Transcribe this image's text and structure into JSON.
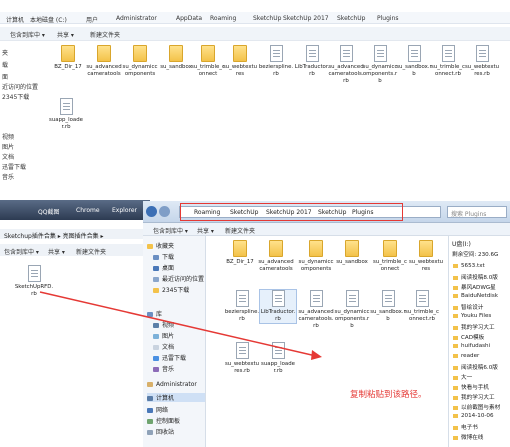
{
  "top_window": {
    "breadcrumb": [
      "计算机",
      "本地磁盘 (C:)",
      "用户",
      "Administrator",
      "AppData",
      "Roaming",
      "SketchUp",
      "SketchUp 2017",
      "SketchUp",
      "Plugins"
    ],
    "toolbar": [
      "包含到库中 ▾",
      "共享 ▾",
      "新建文件夹"
    ],
    "sidebar": [
      "夹",
      "载",
      "面",
      "近访问的位置",
      "2345下载",
      "视频",
      "图片",
      "文档",
      "迅雷下载",
      "音乐"
    ],
    "files": [
      "BZ_Dir_17",
      "su_advancedcameratools",
      "su_dynamiccomponents",
      "su_sandbox",
      "su_trimble_connect",
      "su_webtextures",
      "bezierspline.rb",
      "LibTraductor.rb",
      "su_advancedcameratools.rb",
      "su_dynamiccomponents.rb",
      "su_sandbox.rb",
      "su_trimble_connect.rb",
      "su_webtextures.rb",
      "suapp_loader.rb"
    ]
  },
  "taskbar": [
    "QQ截图",
    "Chrome",
    "Explorer"
  ],
  "left_window": {
    "address": "Sketchup插件合集 ▸ 亮图插件合集 ▸",
    "toolbar": [
      "包含到库中 ▾",
      "共享 ▾",
      "新建文件夹"
    ],
    "file": "SketchUpRFD.rb"
  },
  "main_window": {
    "address": [
      "Roaming",
      "SketchUp",
      "SketchUp 2017",
      "SketchUp",
      "Plugins"
    ],
    "search_placeholder": "搜索 Plugins",
    "toolbar": [
      "包含到库中 ▾",
      "共享 ▾",
      "新建文件夹"
    ],
    "nav": [
      "收藏夹",
      "下载",
      "桌面",
      "最近访问的位置",
      "2345下载",
      "库",
      "视频",
      "图片",
      "文档",
      "迅雷下载",
      "音乐",
      "Administrator",
      "计算机",
      "网络",
      "控制面板",
      "回收站"
    ],
    "files": [
      "BZ_Dir_17",
      "su_advancedcameratools",
      "su_dynamiccomponents",
      "su_sandbox",
      "su_trimble_connect",
      "su_webtextures",
      "bezierspline.rb",
      "LibTraductor.rb",
      "su_advancedcameratools.rb",
      "su_dynamiccomponents.rb",
      "su_sandbox.rb",
      "su_trimble_connect.rb",
      "su_webtextures.rb",
      "suapp_loader.rb"
    ],
    "right_panel": {
      "drive": "U盘(I:)",
      "free": "剩余空间: 230.6G",
      "items": [
        "5653.txt",
        "阅读投稿8.0版",
        "暴风ADWG星",
        "BaiduNetdisk",
        "智绘设计",
        "Youku Files",
        "我的学习大工",
        "CAD模板",
        "huifudashi",
        "reader",
        "阅读投稿6.0版",
        "大一",
        "快看与手机",
        "我的学习大工",
        "以前截图与素材",
        "2014-10-06",
        "电子书",
        "微博在线"
      ]
    },
    "annotation": "复制粘贴到该路径。"
  },
  "accent": "#e53935"
}
